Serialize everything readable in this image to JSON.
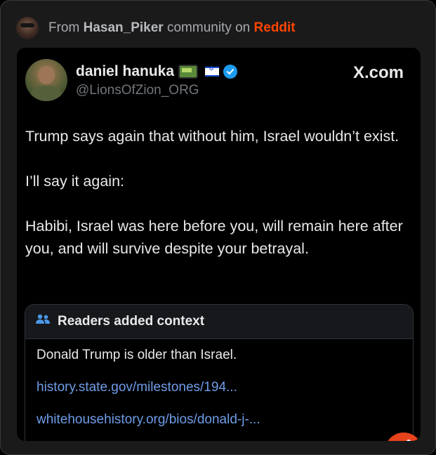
{
  "source": {
    "from_label": "From",
    "community": "Hasan_Piker",
    "community_suffix": "community on",
    "platform": "Reddit"
  },
  "tweet": {
    "display_name": "daniel hanuka",
    "handle": "@LionsOfZion_ORG",
    "site": "X.com",
    "paragraphs": [
      "Trump says again that without him, Israel wouldn’t exist.",
      "I’ll say it again:",
      "Habibi, Israel was here before you, will remain here after you, and will survive despite your betrayal."
    ],
    "context": {
      "header": "Readers added context",
      "text": "Donald Trump is older than Israel.",
      "links": [
        "history.state.gov/milestones/194...",
        "whitehousehistory.org/bios/donald-j-..."
      ]
    }
  },
  "icons": {
    "verified": "verified-badge-icon",
    "pager": "pager-emoji-icon",
    "flag": "israel-flag-icon",
    "readers": "people-icon",
    "reddit": "reddit-snoo-icon"
  },
  "colors": {
    "reddit_orange": "#ff4500",
    "link_blue": "#6f9de8",
    "verified_blue": "#1d9bf0"
  }
}
